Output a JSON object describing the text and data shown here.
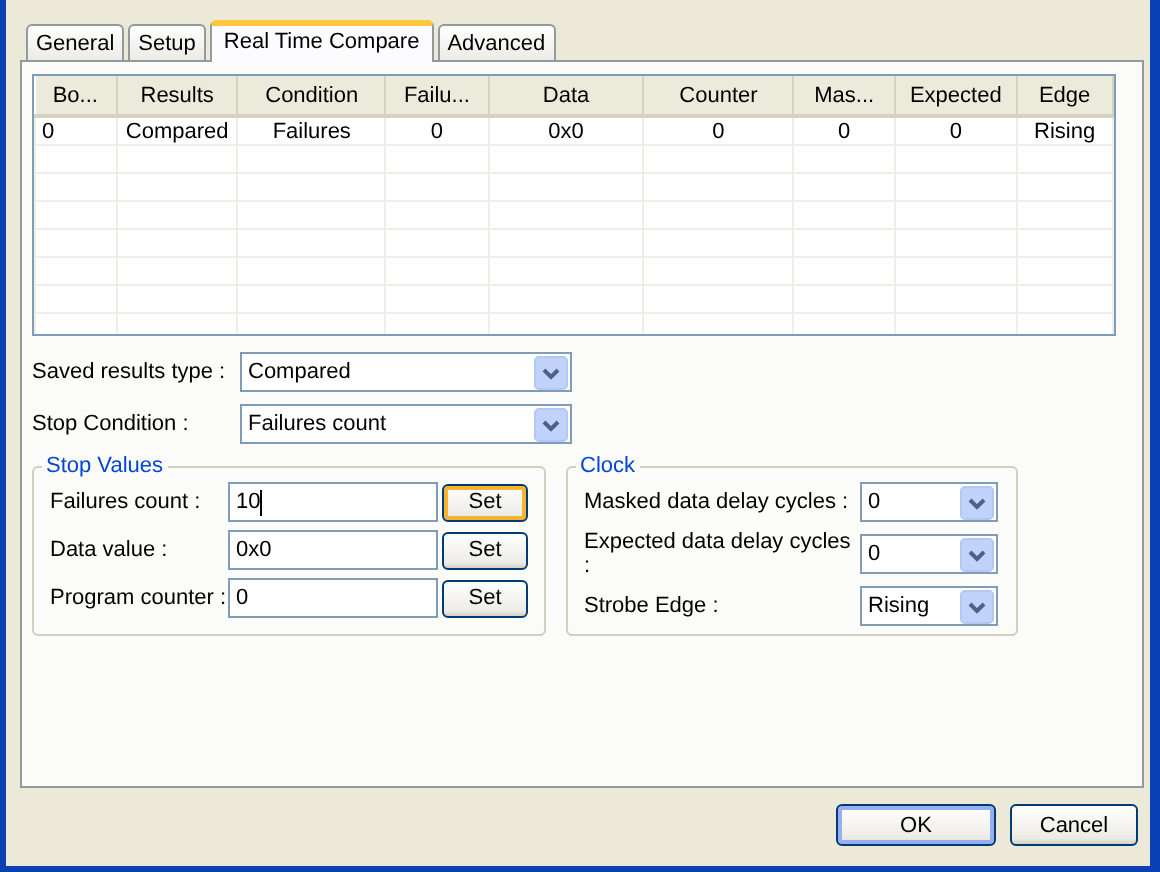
{
  "tabs": [
    {
      "label": "General",
      "selected": false
    },
    {
      "label": "Setup",
      "selected": false
    },
    {
      "label": "Real Time Compare",
      "selected": true
    },
    {
      "label": "Advanced",
      "selected": false
    }
  ],
  "table": {
    "columns": [
      "Bo...",
      "Results",
      "Condition",
      "Failu...",
      "Data",
      "Counter",
      "Mas...",
      "Expected",
      "Edge"
    ],
    "rows": [
      [
        "0",
        "Compared",
        "Failures",
        "0",
        "0x0",
        "0",
        "0",
        "0",
        "Rising"
      ]
    ]
  },
  "settings": [
    {
      "label": "Saved results type :",
      "value": "Compared"
    },
    {
      "label": "Stop Condition :",
      "value": "Failures count"
    }
  ],
  "stop_values": {
    "title": "Stop Values",
    "fields": [
      {
        "label": "Failures count :",
        "value": "10",
        "button": "Set",
        "hot": true
      },
      {
        "label": "Data value :",
        "value": "0x0",
        "button": "Set",
        "hot": false
      },
      {
        "label": "Program counter :",
        "value": "0",
        "button": "Set",
        "hot": false
      }
    ]
  },
  "clock": {
    "title": "Clock",
    "fields": [
      {
        "label": "Masked data delay cycles :",
        "value": "0"
      },
      {
        "label": "Expected data delay cycles :",
        "value": "0"
      },
      {
        "label": "Strobe Edge :",
        "value": "Rising"
      }
    ]
  },
  "buttons": [
    {
      "label": "OK",
      "default": true
    },
    {
      "label": "Cancel",
      "default": false
    }
  ]
}
